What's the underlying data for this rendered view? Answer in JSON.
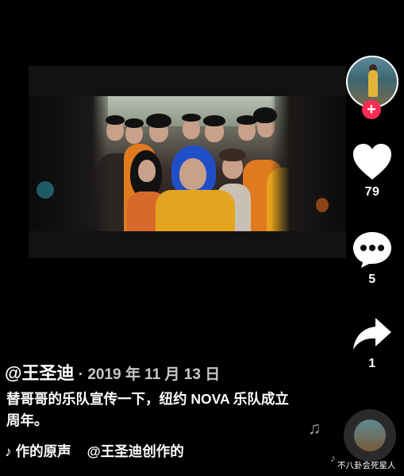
{
  "author": {
    "name": "@王圣迪",
    "date_sep": " · ",
    "date": "2019 年 11 月 13 日"
  },
  "caption": "替哥哥的乐队宣传一下，纽约 NOVA 乐队成立周年。",
  "music": {
    "note_icon": "♪",
    "text_left": "作的原声",
    "text_right": "@王圣迪创作的"
  },
  "actions": {
    "follow_icon": "+",
    "likes": "79",
    "comments": "5",
    "shares": "1"
  },
  "watermark": "不八卦会死星人",
  "colors": {
    "follow_red": "#fe2c55",
    "background": "#000000",
    "icon_white": "#ffffff"
  },
  "icons": [
    "heart-icon",
    "comment-icon",
    "share-icon",
    "music-note-icon",
    "plus-icon"
  ]
}
